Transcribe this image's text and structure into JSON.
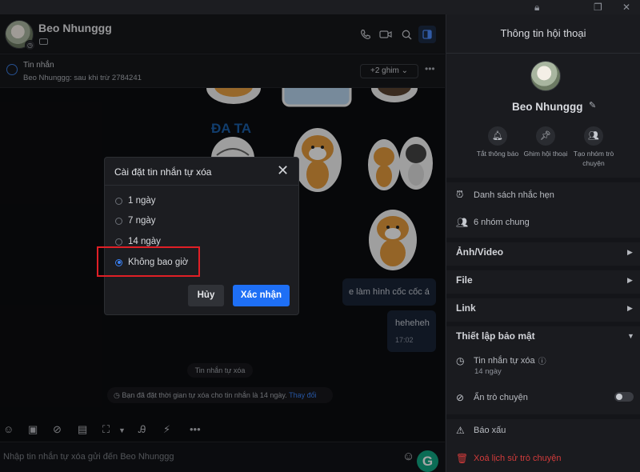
{
  "titlebar": {
    "icons": [
      "lock-icon",
      "restore-icon",
      "close-icon"
    ]
  },
  "header": {
    "contact_name": "Beo Nhunggg"
  },
  "pin": {
    "title": "Tin nhắn",
    "subtitle": "Beo Nhunggg: sau khi trừ 2784241",
    "more_label": "+2 ghim ⌄"
  },
  "chat": {
    "messages": [
      {
        "text": "e làm hình cốc cốc á"
      },
      {
        "text": "heheheh",
        "time": "17:02"
      }
    ],
    "sticker_caption": "ĐA TA",
    "system_title": "Tin nhắn tự xóa",
    "system_notice": "Bạn đã đặt thời gian tự xóa cho tin nhắn là 14 ngày.",
    "system_link": "Thay đổi"
  },
  "modal": {
    "title": "Cài đặt tin nhắn tự xóa",
    "options": [
      {
        "label": "1 ngày",
        "selected": false
      },
      {
        "label": "7 ngày",
        "selected": false
      },
      {
        "label": "14 ngày",
        "selected": false
      },
      {
        "label": "Không bao giờ",
        "selected": true
      }
    ],
    "cancel_label": "Hủy",
    "confirm_label": "Xác nhận"
  },
  "composer": {
    "placeholder": "Nhập tin nhắn tự xóa gửi đến Beo Nhunggg",
    "grammarly_label": "G"
  },
  "panel": {
    "title": "Thông tin hội thoại",
    "name": "Beo Nhunggg",
    "quick_actions": [
      {
        "label": "Tắt thông báo",
        "icon": "bell-icon"
      },
      {
        "label": "Ghim hội thoại",
        "icon": "pin-icon"
      },
      {
        "label": "Tạo nhóm trò chuyện",
        "icon": "add-group-icon"
      }
    ],
    "reminders": "Danh sách nhắc hẹn",
    "groups": "6 nhóm chung",
    "media": "Ảnh/Video",
    "file": "File",
    "link": "Link",
    "security": "Thiết lập bảo mật",
    "self_delete": "Tin nhắn tự xóa",
    "self_delete_value": "14 ngày",
    "hide_chat": "Ẩn trò chuyện",
    "report": "Báo xấu",
    "delete_history": "Xoá lịch sử trò chuyện"
  },
  "colors": {
    "accent": "#1e6ff5",
    "highlight_box": "#e01f26",
    "danger": "#d23b3b"
  }
}
